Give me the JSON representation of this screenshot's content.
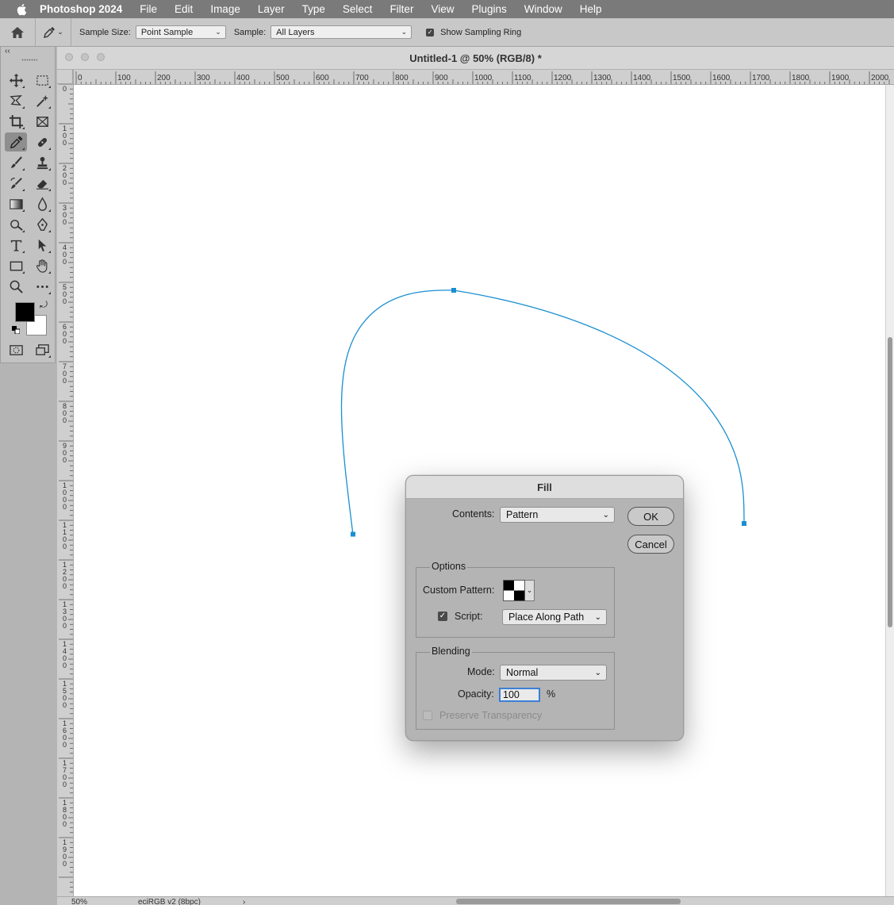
{
  "menubar": {
    "app_name": "Photoshop 2024",
    "items": [
      "File",
      "Edit",
      "Image",
      "Layer",
      "Type",
      "Select",
      "Filter",
      "View",
      "Plugins",
      "Window",
      "Help"
    ]
  },
  "options_bar": {
    "sample_size_label": "Sample Size:",
    "sample_size_value": "Point Sample",
    "sample_label": "Sample:",
    "sample_value": "All Layers",
    "sampling_ring_label": "Show Sampling Ring",
    "sampling_ring_checked": true
  },
  "tools_panel": {
    "collapse_glyph": "‹‹",
    "active_tool": "eyedropper-tool",
    "foreground_color": "#000000",
    "background_color": "#ffffff"
  },
  "document": {
    "title": "Untitled-1 @ 50% (RGB/8) *",
    "h_ruler_labels": [
      "0",
      "100",
      "200",
      "300",
      "400",
      "500",
      "600",
      "700",
      "800",
      "900",
      "1000",
      "1100",
      "1200",
      "1300",
      "1400",
      "1500",
      "1600",
      "1700",
      "1800",
      "1900",
      "2000"
    ],
    "v_ruler_labels": [
      "0",
      "100",
      "200",
      "300",
      "400",
      "500",
      "600",
      "700",
      "800",
      "900",
      "1000",
      "1100",
      "1200",
      "1300",
      "1400",
      "1500",
      "1600",
      "1700",
      "1800",
      "1900"
    ],
    "path_color": "#1a8fd0",
    "status": {
      "zoom": "50%",
      "profile": "eciRGB v2 (8bpc)",
      "arrow": "›"
    }
  },
  "fill_dialog": {
    "title": "Fill",
    "contents_label": "Contents:",
    "contents_value": "Pattern",
    "ok_label": "OK",
    "cancel_label": "Cancel",
    "options_title": "Options",
    "custom_pattern_label": "Custom Pattern:",
    "script_label": "Script:",
    "script_checked": true,
    "script_value": "Place Along Path",
    "blending_title": "Blending",
    "mode_label": "Mode:",
    "mode_value": "Normal",
    "opacity_label": "Opacity:",
    "opacity_value": "100",
    "opacity_unit": "%",
    "preserve_transparency_label": "Preserve Transparency",
    "preserve_transparency_checked": false
  }
}
